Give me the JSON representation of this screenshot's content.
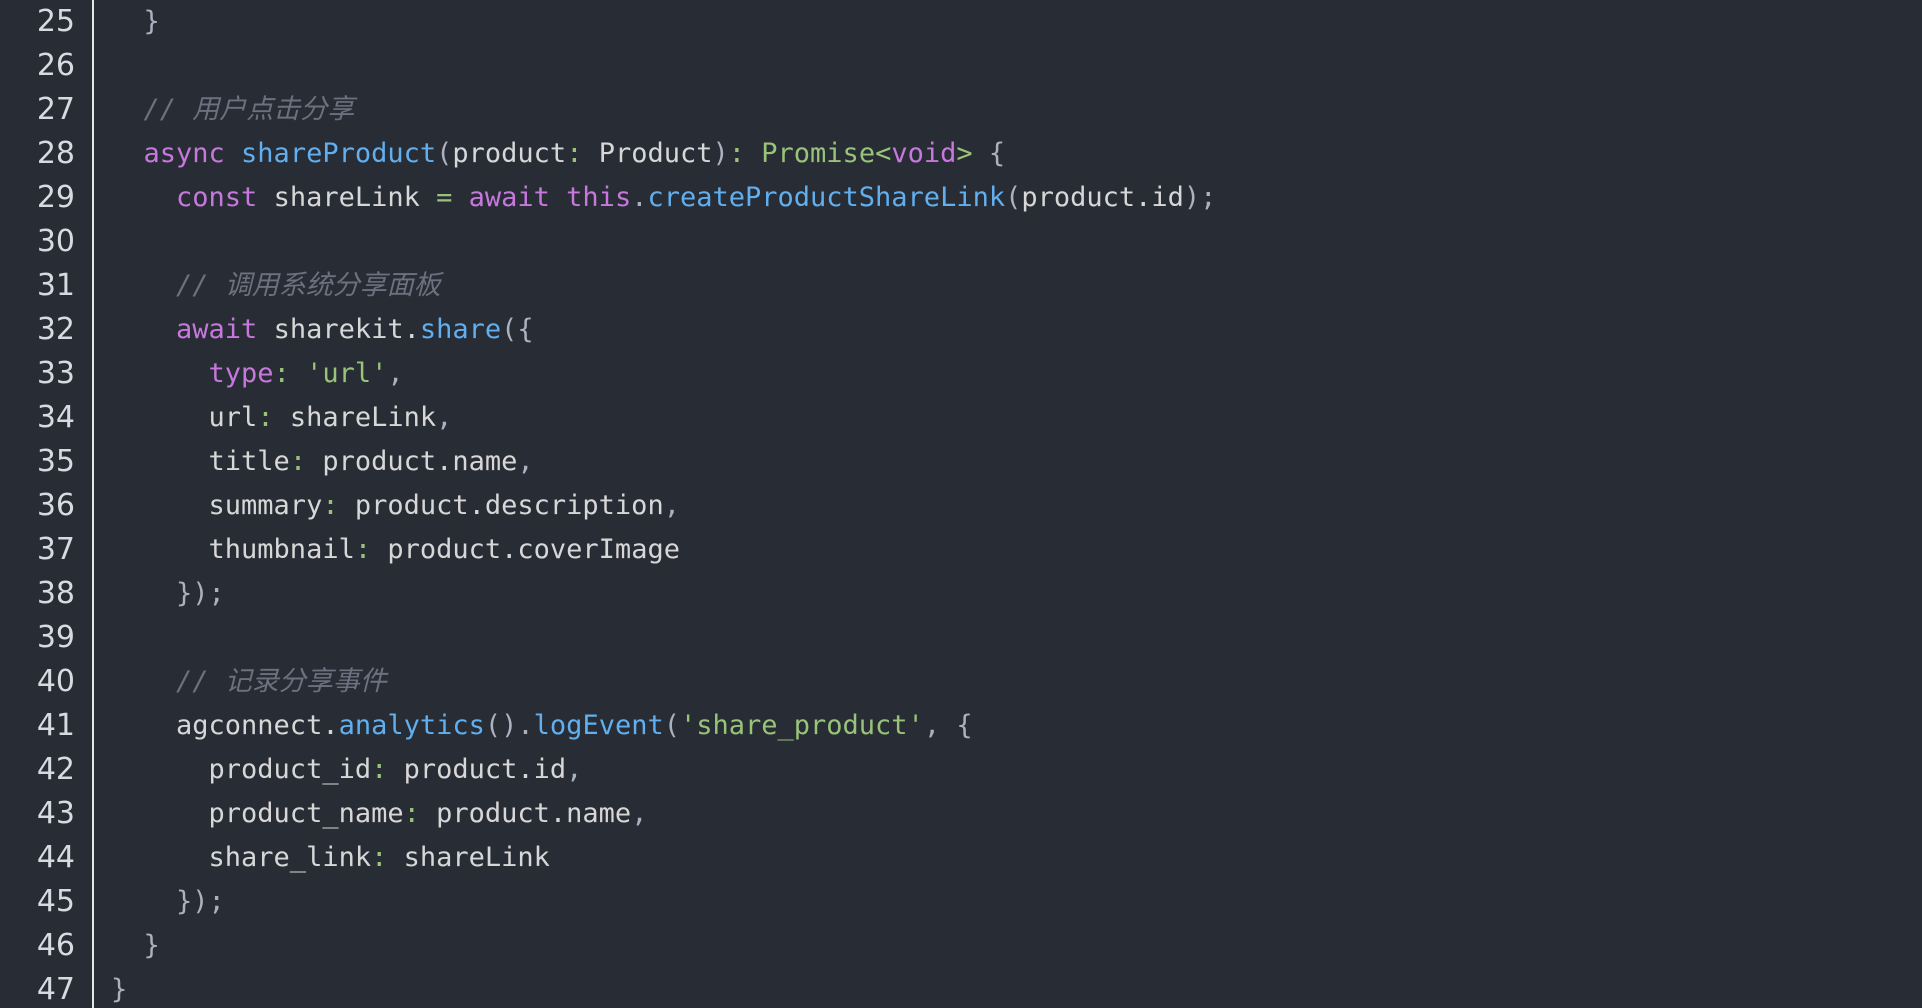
{
  "editor": {
    "lines": [
      {
        "n": "25",
        "tokens": [
          {
            "c": "pn",
            "t": "  }"
          }
        ]
      },
      {
        "n": "26",
        "tokens": []
      },
      {
        "n": "27",
        "tokens": [
          {
            "c": "cm",
            "t": "  // 用户点击分享"
          }
        ]
      },
      {
        "n": "28",
        "tokens": [
          {
            "c": "kw",
            "t": "  async "
          },
          {
            "c": "fn",
            "t": "shareProduct"
          },
          {
            "c": "pn",
            "t": "("
          },
          {
            "c": "tx",
            "t": "product"
          },
          {
            "c": "op",
            "t": ": "
          },
          {
            "c": "tx",
            "t": "Product"
          },
          {
            "c": "pn",
            "t": ")"
          },
          {
            "c": "op",
            "t": ": "
          },
          {
            "c": "pr",
            "t": "Promise"
          },
          {
            "c": "op",
            "t": "<"
          },
          {
            "c": "kw",
            "t": "void"
          },
          {
            "c": "op",
            "t": ">"
          },
          {
            "c": "pn",
            "t": " {"
          }
        ]
      },
      {
        "n": "29",
        "tokens": [
          {
            "c": "kw",
            "t": "    const "
          },
          {
            "c": "tx",
            "t": "shareLink "
          },
          {
            "c": "op",
            "t": "= "
          },
          {
            "c": "kw",
            "t": "await this"
          },
          {
            "c": "pn",
            "t": "."
          },
          {
            "c": "fn",
            "t": "createProductShareLink"
          },
          {
            "c": "pn",
            "t": "("
          },
          {
            "c": "tx",
            "t": "product.id"
          },
          {
            "c": "pn",
            "t": ");"
          }
        ]
      },
      {
        "n": "30",
        "tokens": []
      },
      {
        "n": "31",
        "tokens": [
          {
            "c": "cm",
            "t": "    // 调用系统分享面板"
          }
        ]
      },
      {
        "n": "32",
        "tokens": [
          {
            "c": "kw",
            "t": "    await "
          },
          {
            "c": "tx",
            "t": "sharekit."
          },
          {
            "c": "fn",
            "t": "share"
          },
          {
            "c": "pn",
            "t": "({"
          }
        ]
      },
      {
        "n": "33",
        "tokens": [
          {
            "c": "ty",
            "t": "      type"
          },
          {
            "c": "op",
            "t": ": "
          },
          {
            "c": "str",
            "t": "'url'"
          },
          {
            "c": "pn",
            "t": ","
          }
        ]
      },
      {
        "n": "34",
        "tokens": [
          {
            "c": "tx",
            "t": "      url"
          },
          {
            "c": "op",
            "t": ": "
          },
          {
            "c": "tx",
            "t": "shareLink"
          },
          {
            "c": "pn",
            "t": ","
          }
        ]
      },
      {
        "n": "35",
        "tokens": [
          {
            "c": "tx",
            "t": "      title"
          },
          {
            "c": "op",
            "t": ": "
          },
          {
            "c": "tx",
            "t": "product.name"
          },
          {
            "c": "pn",
            "t": ","
          }
        ]
      },
      {
        "n": "36",
        "tokens": [
          {
            "c": "tx",
            "t": "      summary"
          },
          {
            "c": "op",
            "t": ": "
          },
          {
            "c": "tx",
            "t": "product.description"
          },
          {
            "c": "pn",
            "t": ","
          }
        ]
      },
      {
        "n": "37",
        "tokens": [
          {
            "c": "tx",
            "t": "      thumbnail"
          },
          {
            "c": "op",
            "t": ": "
          },
          {
            "c": "tx",
            "t": "product.coverImage"
          }
        ]
      },
      {
        "n": "38",
        "tokens": [
          {
            "c": "pn",
            "t": "    });"
          }
        ]
      },
      {
        "n": "39",
        "tokens": []
      },
      {
        "n": "40",
        "tokens": [
          {
            "c": "cm",
            "t": "    // 记录分享事件"
          }
        ]
      },
      {
        "n": "41",
        "tokens": [
          {
            "c": "tx",
            "t": "    agconnect."
          },
          {
            "c": "fn",
            "t": "analytics"
          },
          {
            "c": "pn",
            "t": "()."
          },
          {
            "c": "fn",
            "t": "logEvent"
          },
          {
            "c": "pn",
            "t": "("
          },
          {
            "c": "str",
            "t": "'share_product'"
          },
          {
            "c": "pn",
            "t": ", {"
          }
        ]
      },
      {
        "n": "42",
        "tokens": [
          {
            "c": "tx",
            "t": "      product_id"
          },
          {
            "c": "op",
            "t": ": "
          },
          {
            "c": "tx",
            "t": "product.id"
          },
          {
            "c": "pn",
            "t": ","
          }
        ]
      },
      {
        "n": "43",
        "tokens": [
          {
            "c": "tx",
            "t": "      product_name"
          },
          {
            "c": "op",
            "t": ": "
          },
          {
            "c": "tx",
            "t": "product.name"
          },
          {
            "c": "pn",
            "t": ","
          }
        ]
      },
      {
        "n": "44",
        "tokens": [
          {
            "c": "tx",
            "t": "      share_link"
          },
          {
            "c": "op",
            "t": ": "
          },
          {
            "c": "tx",
            "t": "shareLink"
          }
        ]
      },
      {
        "n": "45",
        "tokens": [
          {
            "c": "pn",
            "t": "    });"
          }
        ]
      },
      {
        "n": "46",
        "tokens": [
          {
            "c": "pn",
            "t": "  }"
          }
        ]
      },
      {
        "n": "47",
        "tokens": [
          {
            "c": "pn",
            "t": "}"
          }
        ]
      }
    ]
  }
}
